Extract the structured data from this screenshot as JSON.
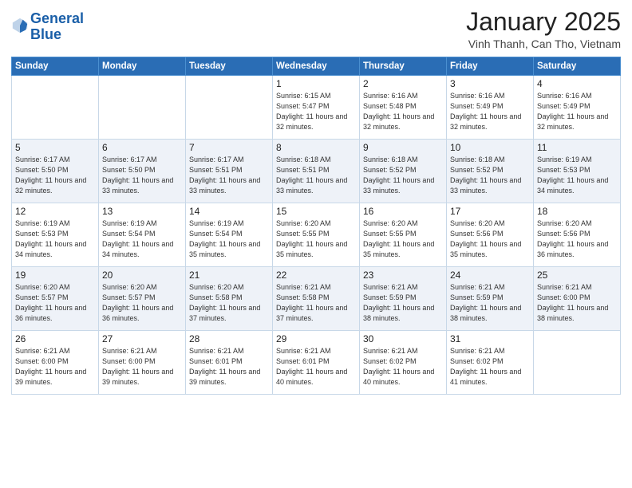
{
  "header": {
    "logo_line1": "General",
    "logo_line2": "Blue",
    "month_year": "January 2025",
    "location": "Vinh Thanh, Can Tho, Vietnam"
  },
  "days_of_week": [
    "Sunday",
    "Monday",
    "Tuesday",
    "Wednesday",
    "Thursday",
    "Friday",
    "Saturday"
  ],
  "weeks": [
    [
      {
        "day": "",
        "info": ""
      },
      {
        "day": "",
        "info": ""
      },
      {
        "day": "",
        "info": ""
      },
      {
        "day": "1",
        "info": "Sunrise: 6:15 AM\nSunset: 5:47 PM\nDaylight: 11 hours and 32 minutes."
      },
      {
        "day": "2",
        "info": "Sunrise: 6:16 AM\nSunset: 5:48 PM\nDaylight: 11 hours and 32 minutes."
      },
      {
        "day": "3",
        "info": "Sunrise: 6:16 AM\nSunset: 5:49 PM\nDaylight: 11 hours and 32 minutes."
      },
      {
        "day": "4",
        "info": "Sunrise: 6:16 AM\nSunset: 5:49 PM\nDaylight: 11 hours and 32 minutes."
      }
    ],
    [
      {
        "day": "5",
        "info": "Sunrise: 6:17 AM\nSunset: 5:50 PM\nDaylight: 11 hours and 32 minutes."
      },
      {
        "day": "6",
        "info": "Sunrise: 6:17 AM\nSunset: 5:50 PM\nDaylight: 11 hours and 33 minutes."
      },
      {
        "day": "7",
        "info": "Sunrise: 6:17 AM\nSunset: 5:51 PM\nDaylight: 11 hours and 33 minutes."
      },
      {
        "day": "8",
        "info": "Sunrise: 6:18 AM\nSunset: 5:51 PM\nDaylight: 11 hours and 33 minutes."
      },
      {
        "day": "9",
        "info": "Sunrise: 6:18 AM\nSunset: 5:52 PM\nDaylight: 11 hours and 33 minutes."
      },
      {
        "day": "10",
        "info": "Sunrise: 6:18 AM\nSunset: 5:52 PM\nDaylight: 11 hours and 33 minutes."
      },
      {
        "day": "11",
        "info": "Sunrise: 6:19 AM\nSunset: 5:53 PM\nDaylight: 11 hours and 34 minutes."
      }
    ],
    [
      {
        "day": "12",
        "info": "Sunrise: 6:19 AM\nSunset: 5:53 PM\nDaylight: 11 hours and 34 minutes."
      },
      {
        "day": "13",
        "info": "Sunrise: 6:19 AM\nSunset: 5:54 PM\nDaylight: 11 hours and 34 minutes."
      },
      {
        "day": "14",
        "info": "Sunrise: 6:19 AM\nSunset: 5:54 PM\nDaylight: 11 hours and 35 minutes."
      },
      {
        "day": "15",
        "info": "Sunrise: 6:20 AM\nSunset: 5:55 PM\nDaylight: 11 hours and 35 minutes."
      },
      {
        "day": "16",
        "info": "Sunrise: 6:20 AM\nSunset: 5:55 PM\nDaylight: 11 hours and 35 minutes."
      },
      {
        "day": "17",
        "info": "Sunrise: 6:20 AM\nSunset: 5:56 PM\nDaylight: 11 hours and 35 minutes."
      },
      {
        "day": "18",
        "info": "Sunrise: 6:20 AM\nSunset: 5:56 PM\nDaylight: 11 hours and 36 minutes."
      }
    ],
    [
      {
        "day": "19",
        "info": "Sunrise: 6:20 AM\nSunset: 5:57 PM\nDaylight: 11 hours and 36 minutes."
      },
      {
        "day": "20",
        "info": "Sunrise: 6:20 AM\nSunset: 5:57 PM\nDaylight: 11 hours and 36 minutes."
      },
      {
        "day": "21",
        "info": "Sunrise: 6:20 AM\nSunset: 5:58 PM\nDaylight: 11 hours and 37 minutes."
      },
      {
        "day": "22",
        "info": "Sunrise: 6:21 AM\nSunset: 5:58 PM\nDaylight: 11 hours and 37 minutes."
      },
      {
        "day": "23",
        "info": "Sunrise: 6:21 AM\nSunset: 5:59 PM\nDaylight: 11 hours and 38 minutes."
      },
      {
        "day": "24",
        "info": "Sunrise: 6:21 AM\nSunset: 5:59 PM\nDaylight: 11 hours and 38 minutes."
      },
      {
        "day": "25",
        "info": "Sunrise: 6:21 AM\nSunset: 6:00 PM\nDaylight: 11 hours and 38 minutes."
      }
    ],
    [
      {
        "day": "26",
        "info": "Sunrise: 6:21 AM\nSunset: 6:00 PM\nDaylight: 11 hours and 39 minutes."
      },
      {
        "day": "27",
        "info": "Sunrise: 6:21 AM\nSunset: 6:00 PM\nDaylight: 11 hours and 39 minutes."
      },
      {
        "day": "28",
        "info": "Sunrise: 6:21 AM\nSunset: 6:01 PM\nDaylight: 11 hours and 39 minutes."
      },
      {
        "day": "29",
        "info": "Sunrise: 6:21 AM\nSunset: 6:01 PM\nDaylight: 11 hours and 40 minutes."
      },
      {
        "day": "30",
        "info": "Sunrise: 6:21 AM\nSunset: 6:02 PM\nDaylight: 11 hours and 40 minutes."
      },
      {
        "day": "31",
        "info": "Sunrise: 6:21 AM\nSunset: 6:02 PM\nDaylight: 11 hours and 41 minutes."
      },
      {
        "day": "",
        "info": ""
      }
    ]
  ]
}
